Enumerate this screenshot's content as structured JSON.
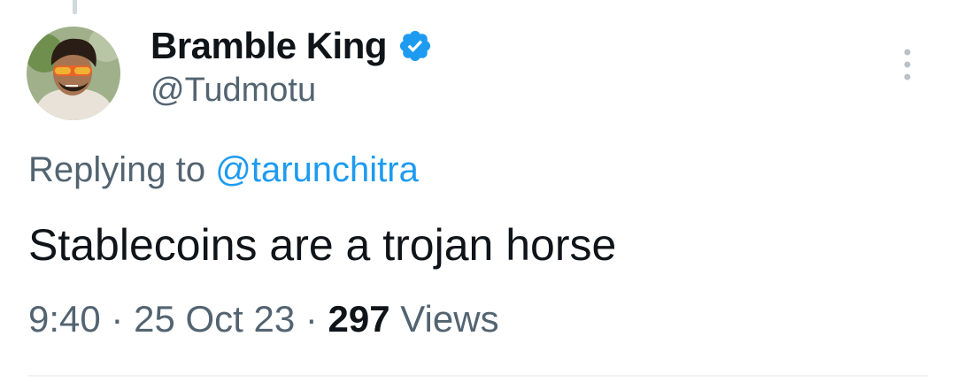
{
  "author": {
    "display_name": "Bramble King",
    "handle": "@Tudmotu",
    "verified": true,
    "verified_color": "#1d9bf0",
    "avatar_icon": "profile-photo"
  },
  "reply": {
    "prefix": "Replying to",
    "mention": "@tarunchitra"
  },
  "tweet": {
    "text": "Stablecoins are a trojan horse"
  },
  "meta": {
    "time": "9:40",
    "separator": "·",
    "date": "25 Oct 23",
    "views_count": "297",
    "views_label": "Views"
  },
  "colors": {
    "text_primary": "#0f1419",
    "text_secondary": "#536471",
    "link": "#1d9bf0",
    "divider": "#eff3f4"
  },
  "icons": {
    "more": "more-vertical-icon",
    "verified": "verified-badge-icon"
  }
}
